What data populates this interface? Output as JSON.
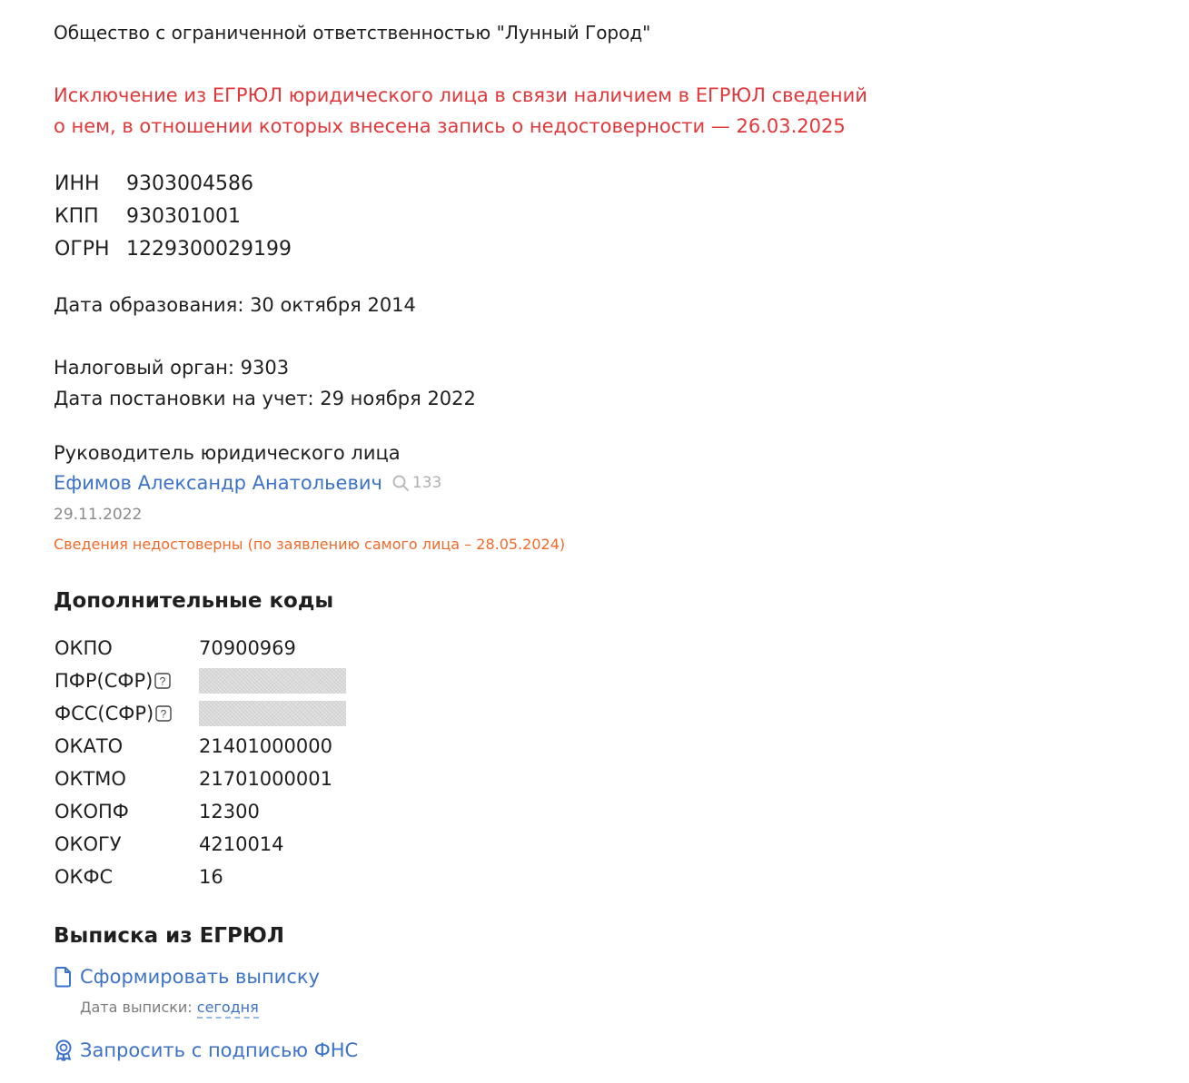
{
  "company": {
    "name": "Общество с ограниченной ответственностью \"Лунный Город\""
  },
  "status": {
    "exclusion_line1": "Исключение из ЕГРЮЛ юридического лица в связи наличием в ЕГРЮЛ сведений",
    "exclusion_line2": "о нем, в отношении которых внесена запись о недостоверности — 26.03.2025",
    "color": "#e0383b"
  },
  "identifiers": [
    {
      "label": "ИНН",
      "value": "9303004586"
    },
    {
      "label": "КПП",
      "value": "930301001"
    },
    {
      "label": "ОГРН",
      "value": "1229300029199"
    }
  ],
  "registration": {
    "text": "Дата образования: 30 октября 2014"
  },
  "tax": {
    "authority": "Налоговый орган: 9303",
    "registered": "Дата постановки на учет: 29 ноября 2022"
  },
  "head": {
    "title": "Руководитель юридического лица",
    "name": "Ефимов Александр Анатольевич",
    "search_icon": "search-icon",
    "search_count": "133",
    "date": "29.11.2022",
    "warning": "Сведения недостоверны (по заявлению самого лица – 28.05.2024)",
    "warning_color": "#f06a2a",
    "link_color": "#3c73c8"
  },
  "codes_section": {
    "title": "Дополнительные коды",
    "rows": [
      {
        "label": "ОКПО",
        "value": "70900969"
      },
      {
        "label": "ПФР(СФР)",
        "value": "",
        "masked": true,
        "icon": "question-icon"
      },
      {
        "label": "ФСС(СФР)",
        "value": "",
        "masked": true,
        "icon": "question-icon"
      },
      {
        "label": "ОКАТО",
        "value": "21401000000"
      },
      {
        "label": "ОКТМО",
        "value": "21701000001"
      },
      {
        "label": "ОКОПФ",
        "value": "12300"
      },
      {
        "label": "ОКОГУ",
        "value": "4210014"
      },
      {
        "label": "ОКФС",
        "value": "16"
      }
    ]
  },
  "egrul_section": {
    "title": "Выписка из ЕГРЮЛ",
    "generate_label": "Сформировать выписку",
    "generate_icon": "document-icon",
    "date_label": "Дата выписки:",
    "date_value": "сегодня",
    "fns_label": "Запросить с подписью ФНС",
    "fns_icon": "seal-icon"
  }
}
